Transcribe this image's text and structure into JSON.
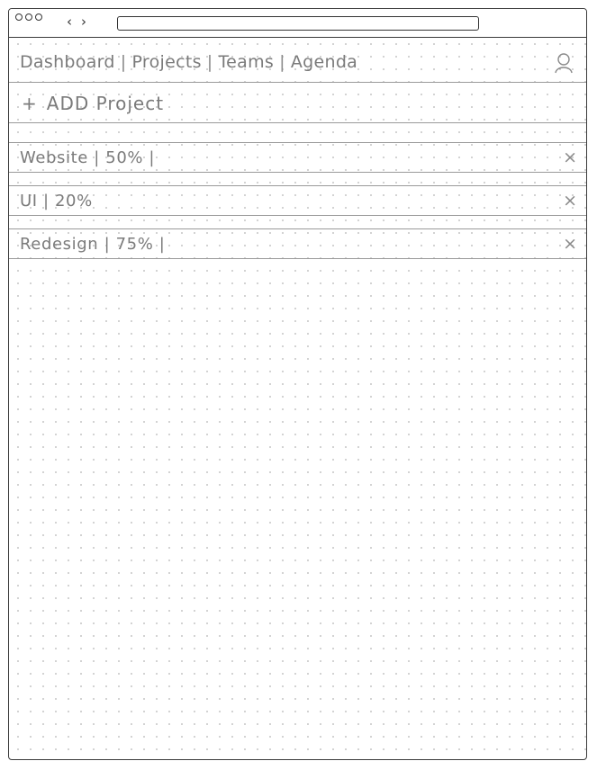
{
  "window": {
    "controls": [
      "close",
      "minimize",
      "maximize"
    ],
    "back_glyph": "‹",
    "forward_glyph": "›",
    "url": ""
  },
  "nav": {
    "items": [
      {
        "label": "Dashboard",
        "active": false
      },
      {
        "label": "Projects",
        "active": true
      },
      {
        "label": "Teams",
        "active": false
      },
      {
        "label": "Agenda",
        "active": false
      }
    ],
    "separator": "|",
    "user_icon": "user-icon"
  },
  "toolbar": {
    "add_plus": "+",
    "add_label": "ADD Project"
  },
  "projects": [
    {
      "text": "Website | 50% |",
      "close": "×"
    },
    {
      "text": "UI | 20%",
      "close": "×"
    },
    {
      "text": "Redesign | 75% |",
      "close": "×"
    }
  ],
  "colors": {
    "frame": "#3a3a3a",
    "text": "#7b7b7b",
    "grid_dot": "#c8c8c8",
    "row_border": "#9a9a9a"
  }
}
